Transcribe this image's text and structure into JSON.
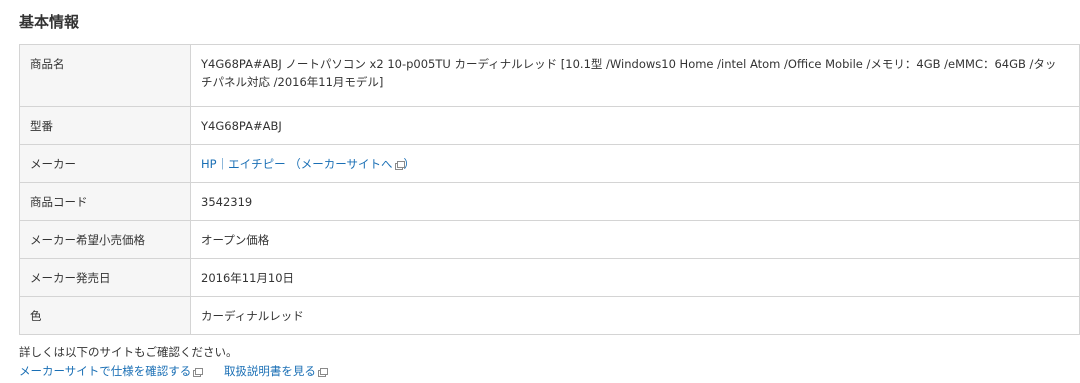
{
  "section": {
    "title": "基本情報"
  },
  "spec": {
    "product_name": {
      "label": "商品名",
      "value": "Y4G68PA#ABJ ノートパソコン x2 10-p005TU カーディナルレッド [10.1型 /Windows10 Home /intel Atom /Office Mobile /メモリ：4GB /eMMC：64GB /タッチパネル対応 /2016年11月モデル]"
    },
    "model_number": {
      "label": "型番",
      "value": "Y4G68PA#ABJ"
    },
    "maker": {
      "label": "メーカー",
      "link_text": "HP｜エイチピー",
      "site_link_text": "（メーカーサイトへ",
      "site_link_close": "）",
      "icon": "external-window-icon"
    },
    "product_code": {
      "label": "商品コード",
      "value": "3542319"
    },
    "retail_price": {
      "label": "メーカー希望小売価格",
      "value": "オープン価格"
    },
    "release_date": {
      "label": "メーカー発売日",
      "value": "2016年11月10日"
    },
    "color": {
      "label": "色",
      "value": "カーディナルレッド"
    }
  },
  "footer": {
    "note": "詳しくは以下のサイトもご確認ください。",
    "maker_site_link": "メーカーサイトで仕様を確認する",
    "manual_link": "取扱説明書を見る",
    "icon": "external-window-icon"
  },
  "colors": {
    "link": "#1a6fb5",
    "border": "#d4d4d4",
    "header_bg": "#f6f6f6",
    "text": "#333333"
  }
}
